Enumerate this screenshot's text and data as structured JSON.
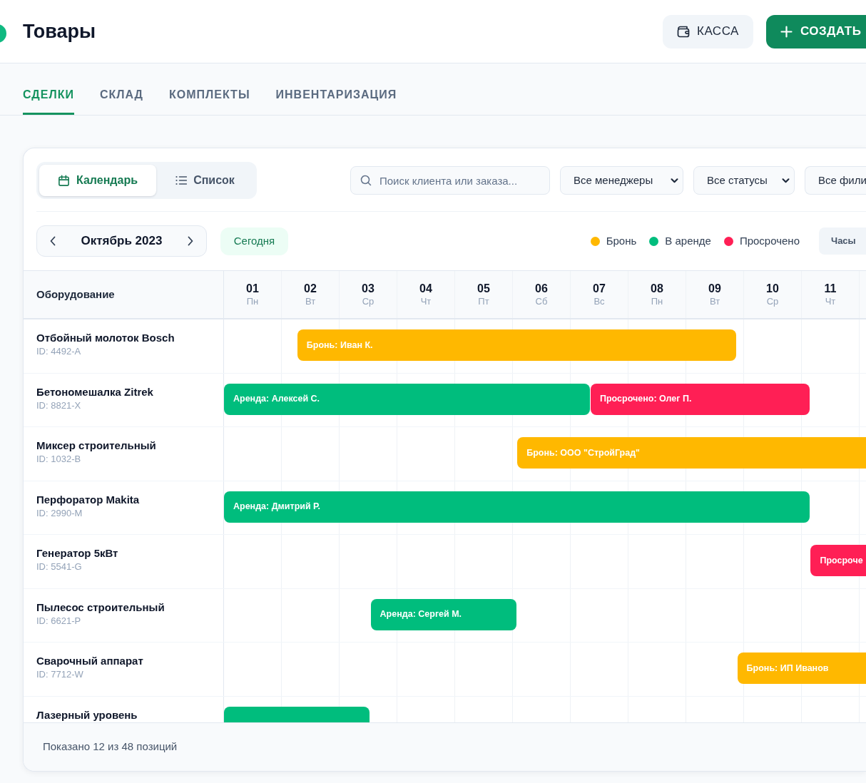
{
  "header": {
    "title": "Товары",
    "buttons": [
      {
        "label": "КАССА",
        "kind": "secondary"
      },
      {
        "label": "СОЗДАТЬ",
        "kind": "primary"
      }
    ]
  },
  "tabs": [
    {
      "label": "СДЕЛКИ",
      "selected": true
    },
    {
      "label": "СКЛАД",
      "selected": false
    },
    {
      "label": "КОМПЛЕКТЫ",
      "selected": false
    },
    {
      "label": "ИНВЕНТАРИЗАЦИЯ",
      "selected": false
    }
  ],
  "view_toggle": [
    {
      "label": "Календарь",
      "selected": true
    },
    {
      "label": "Список",
      "selected": false
    }
  ],
  "search": {
    "placeholder": "Поиск клиента или заказа..."
  },
  "filters": [
    {
      "value": "Все менеджеры"
    },
    {
      "value": "Все статусы"
    },
    {
      "value": "Все фили"
    }
  ],
  "month_navigator": {
    "label": "Октябрь 2023"
  },
  "today_button": {
    "label": "Сегодня"
  },
  "legend": [
    {
      "label": "Бронь",
      "color": "#ffb800"
    },
    {
      "label": "В аренде",
      "color": "#00bd7d"
    },
    {
      "label": "Просрочено",
      "color": "#ff1f55"
    }
  ],
  "scale_button": {
    "label": "Часы"
  },
  "calendar": {
    "column_header": "Оборудование",
    "days": [
      {
        "number": "01",
        "weekday": "Пн"
      },
      {
        "number": "02",
        "weekday": "Вт"
      },
      {
        "number": "03",
        "weekday": "Ср"
      },
      {
        "number": "04",
        "weekday": "Чт"
      },
      {
        "number": "05",
        "weekday": "Пт"
      },
      {
        "number": "06",
        "weekday": "Сб"
      },
      {
        "number": "07",
        "weekday": "Вс"
      },
      {
        "number": "08",
        "weekday": "Пн"
      },
      {
        "number": "09",
        "weekday": "Вт"
      },
      {
        "number": "10",
        "weekday": "Ср"
      },
      {
        "number": "11",
        "weekday": "Чт"
      }
    ],
    "rows": [
      {
        "name": "Отбойный молоток Bosch",
        "id": "ID: 4492-A",
        "bookings": [
          {
            "label": "Бронь: Иван К.",
            "color": "#ffb800"
          }
        ]
      },
      {
        "name": "Бетономешалка Zitrek",
        "id": "ID: 8821-X",
        "bookings": [
          {
            "label": "Аренда: Алексей С.",
            "color": "#00bd7d"
          },
          {
            "label": "Просрочено: Олег П.",
            "color": "#ff1f55"
          }
        ]
      },
      {
        "name": "Миксер строительный",
        "id": "ID: 1032-B",
        "bookings": [
          {
            "label": "Бронь: ООО \"СтройГрад\"",
            "color": "#ffb800"
          }
        ]
      },
      {
        "name": "Перфоратор Makita",
        "id": "ID: 2990-M",
        "bookings": [
          {
            "label": "Аренда: Дмитрий Р.",
            "color": "#00bd7d"
          }
        ]
      },
      {
        "name": "Генератор 5кВт",
        "id": "ID: 5541-G",
        "bookings": [
          {
            "label": "Просроче",
            "color": "#ff1f55"
          }
        ]
      },
      {
        "name": "Пылесос строительный",
        "id": "ID: 6621-P",
        "bookings": [
          {
            "label": "Аренда: Сергей М.",
            "color": "#00bd7d"
          }
        ]
      },
      {
        "name": "Сварочный аппарат",
        "id": "ID: 7712-W",
        "bookings": [
          {
            "label": "Бронь: ИП Иванов",
            "color": "#ffb800"
          }
        ]
      },
      {
        "name": "Лазерный уровень",
        "bookings": [
          {
            "color": "#00bd7d"
          }
        ]
      }
    ]
  },
  "footer": {
    "text": "Показано 12 из 48 позиций"
  }
}
